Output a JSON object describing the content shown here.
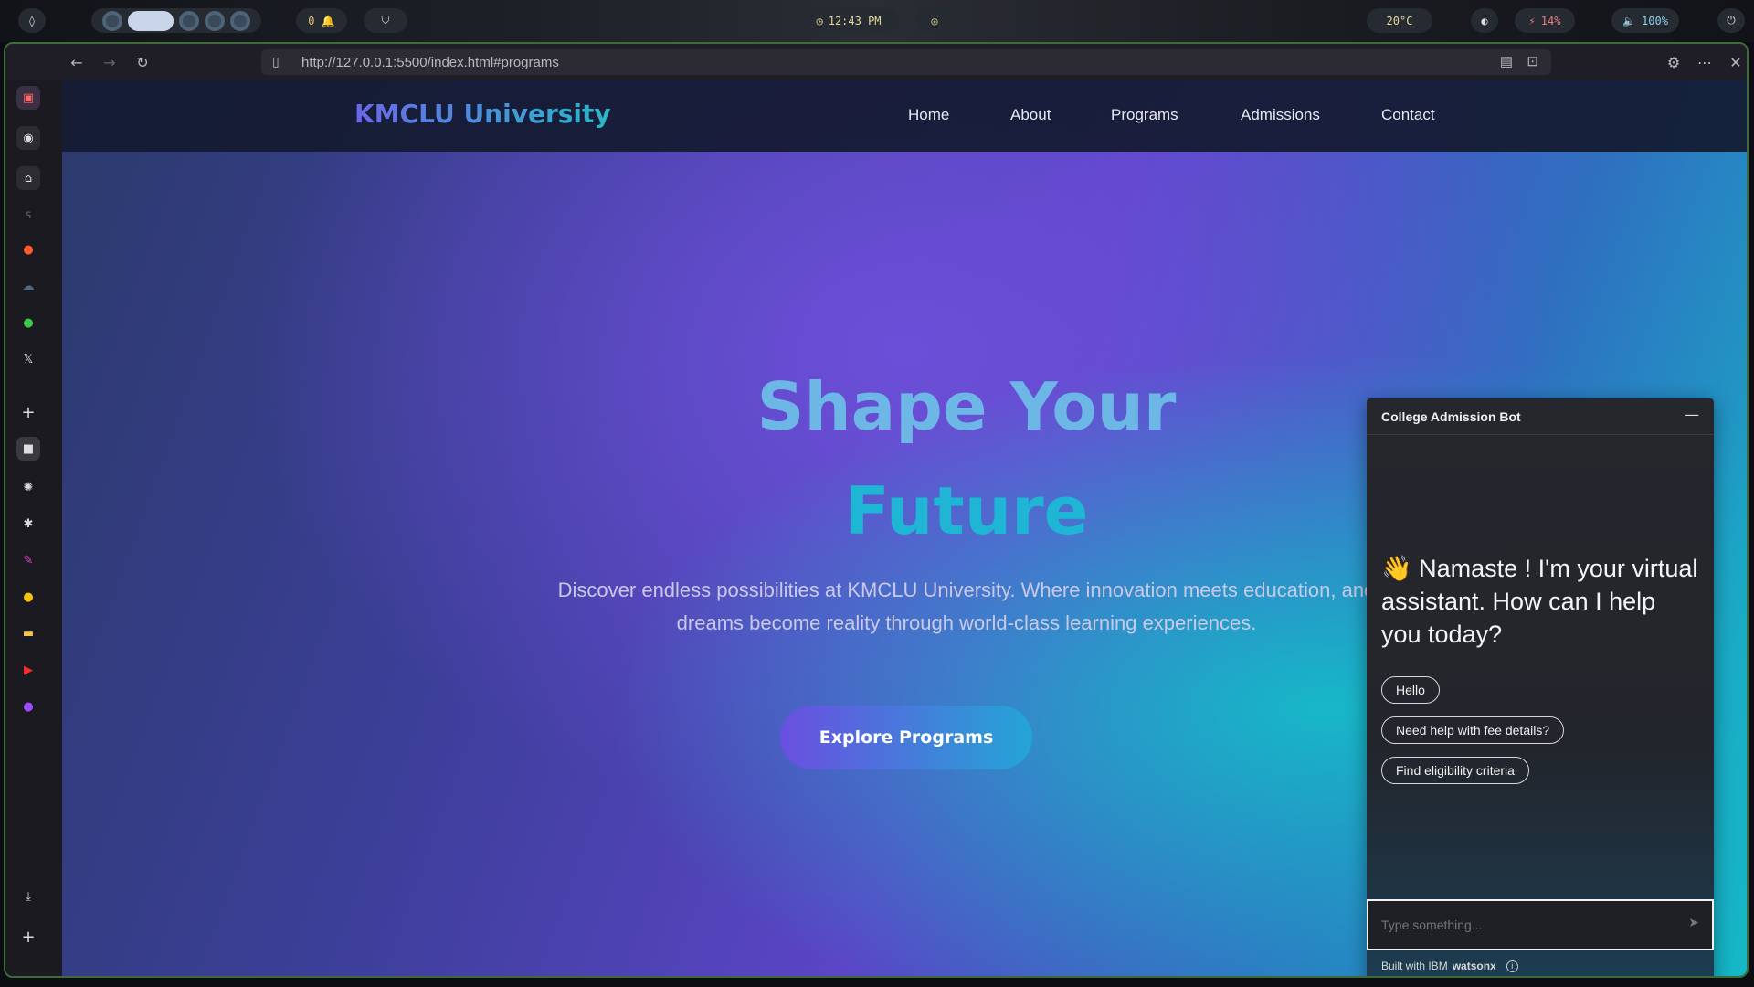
{
  "system_bar": {
    "notifications": "0 🔔",
    "clock": "12:43 PM",
    "weather": "20°C",
    "battery": "14%",
    "volume": "100%"
  },
  "browser": {
    "url": "http://127.0.0.1:5500/index.html#programs"
  },
  "site": {
    "logo": "KMCLU University",
    "nav": [
      "Home",
      "About",
      "Programs",
      "Admissions",
      "Contact"
    ],
    "hero": {
      "title_line1": "Shape Your",
      "title_line2": "Future",
      "subtitle": "Discover endless possibilities at KMCLU University. Where innovation meets education, and dreams become reality through world-class learning experiences.",
      "cta": "Explore Programs"
    }
  },
  "chat": {
    "title": "College Admission Bot",
    "message": "👋 Namaste ! I'm your virtual assistant. How can I help you today?",
    "chips": [
      "Hello",
      "Need help with fee details?",
      "Find eligibility criteria"
    ],
    "input_placeholder": "Type something...",
    "footer_prefix": "Built with IBM",
    "footer_brand": "watsonx"
  },
  "colors": {
    "accent": "#6b67e8",
    "teal": "#2ab8c8"
  }
}
